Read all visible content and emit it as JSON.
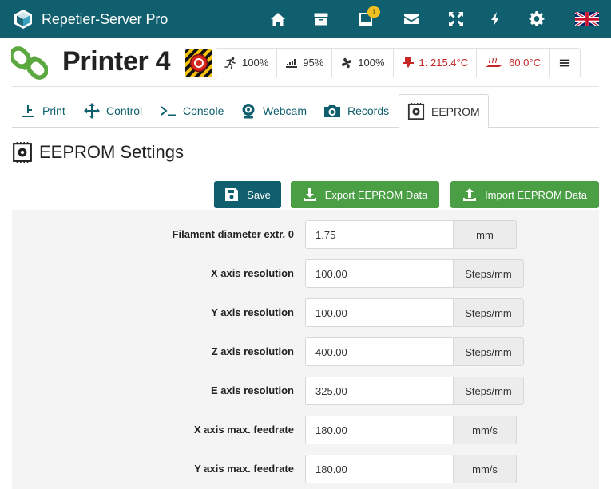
{
  "app": {
    "title": "Repetier-Server Pro"
  },
  "topnav": {
    "items": [
      {
        "name": "home-icon",
        "label": "Home"
      },
      {
        "name": "archive-icon",
        "label": "Archive"
      },
      {
        "name": "tablet-icon",
        "label": "Printers",
        "badge": "1"
      },
      {
        "name": "mail-icon",
        "label": "Messages"
      },
      {
        "name": "fullscreen-icon",
        "label": "Fullscreen"
      },
      {
        "name": "bolt-icon",
        "label": "Power"
      },
      {
        "name": "gear-icon",
        "label": "Settings"
      },
      {
        "name": "flag-uk-icon",
        "label": "Language"
      }
    ]
  },
  "printer": {
    "name": "Printer 4",
    "stats": {
      "speed": "100%",
      "flow": "95%",
      "fan": "100%",
      "extruder": "1: 215.4°C",
      "bed": "60.0°C"
    }
  },
  "tabs": [
    {
      "label": "Print",
      "icon": "print-icon"
    },
    {
      "label": "Control",
      "icon": "move-icon"
    },
    {
      "label": "Console",
      "icon": "terminal-icon"
    },
    {
      "label": "Webcam",
      "icon": "webcam-icon"
    },
    {
      "label": "Records",
      "icon": "camera-icon"
    },
    {
      "label": "EEPROM",
      "icon": "chip-icon",
      "active": true
    }
  ],
  "section": {
    "title": "EEPROM Settings"
  },
  "actions": {
    "save": "Save",
    "export": "Export EEPROM Data",
    "import": "Import EEPROM Data"
  },
  "eeprom_rows": [
    {
      "label": "Filament diameter extr. 0",
      "value": "1.75",
      "unit": "mm"
    },
    {
      "label": "X axis resolution",
      "value": "100.00",
      "unit": "Steps/mm"
    },
    {
      "label": "Y axis resolution",
      "value": "100.00",
      "unit": "Steps/mm"
    },
    {
      "label": "Z axis resolution",
      "value": "400.00",
      "unit": "Steps/mm"
    },
    {
      "label": "E axis resolution",
      "value": "325.00",
      "unit": "Steps/mm"
    },
    {
      "label": "X axis max. feedrate",
      "value": "180.00",
      "unit": "mm/s"
    },
    {
      "label": "Y axis max. feedrate",
      "value": "180.00",
      "unit": "mm/s"
    }
  ],
  "colors": {
    "topbar": "#0f5f6e",
    "accent": "#0f5f6e",
    "green": "#4a9f45",
    "red": "#c62828",
    "badge": "#f0c020"
  }
}
